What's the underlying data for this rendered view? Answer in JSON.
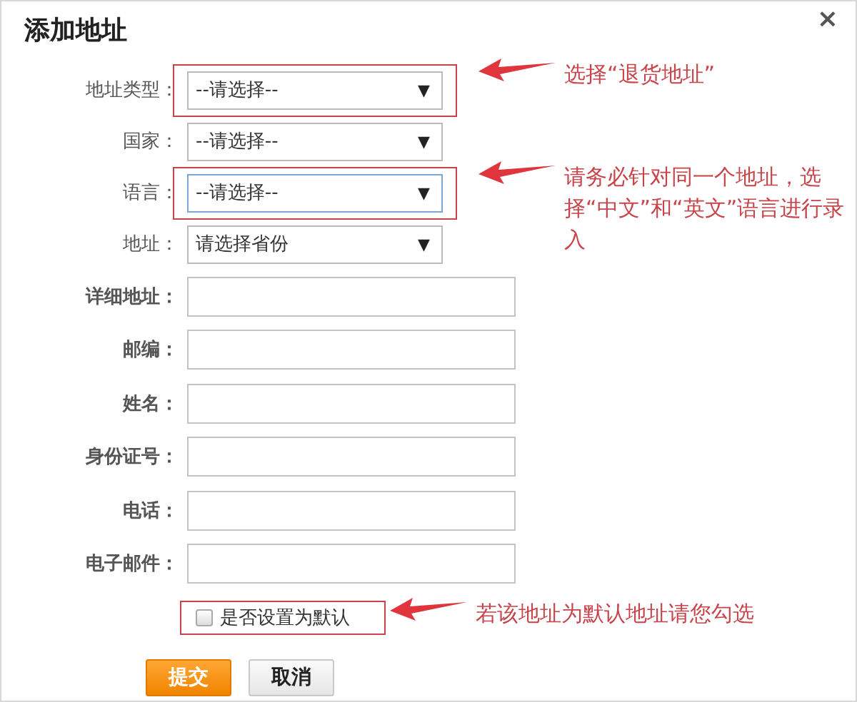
{
  "dialog": {
    "title": "添加地址",
    "close": "×"
  },
  "fields": [
    {
      "kind": "select",
      "label": "地址类型：",
      "value": "--请选择--",
      "caret": "▼",
      "highlighted": true,
      "focused": false,
      "note": "选择“退货地址”"
    },
    {
      "kind": "select",
      "label": "国家：",
      "value": "--请选择--",
      "caret": "▼",
      "highlighted": false,
      "focused": false
    },
    {
      "kind": "select",
      "label": "语言：",
      "value": "--请选择--",
      "caret": "▼",
      "highlighted": true,
      "focused": true,
      "note": "请务必针对同一个地址，选择“中文”和“英文”语言进行录入"
    },
    {
      "kind": "select",
      "label": "地址：",
      "value": "请选择省份",
      "caret": "▼",
      "highlighted": false,
      "focused": false
    },
    {
      "kind": "text",
      "label": "详细地址："
    },
    {
      "kind": "text",
      "label": "邮编："
    },
    {
      "kind": "text",
      "label": "姓名："
    },
    {
      "kind": "text",
      "label": "身份证号："
    },
    {
      "kind": "text",
      "label": "电话："
    },
    {
      "kind": "text",
      "label": "电子邮件："
    }
  ],
  "default_option": {
    "label": "是否设置为默认",
    "checked": false,
    "highlighted": true,
    "note": "若该地址为默认地址请您勾选"
  },
  "buttons": [
    {
      "label": "提交",
      "kind": "primary"
    },
    {
      "label": "取消",
      "kind": "secondary"
    }
  ]
}
